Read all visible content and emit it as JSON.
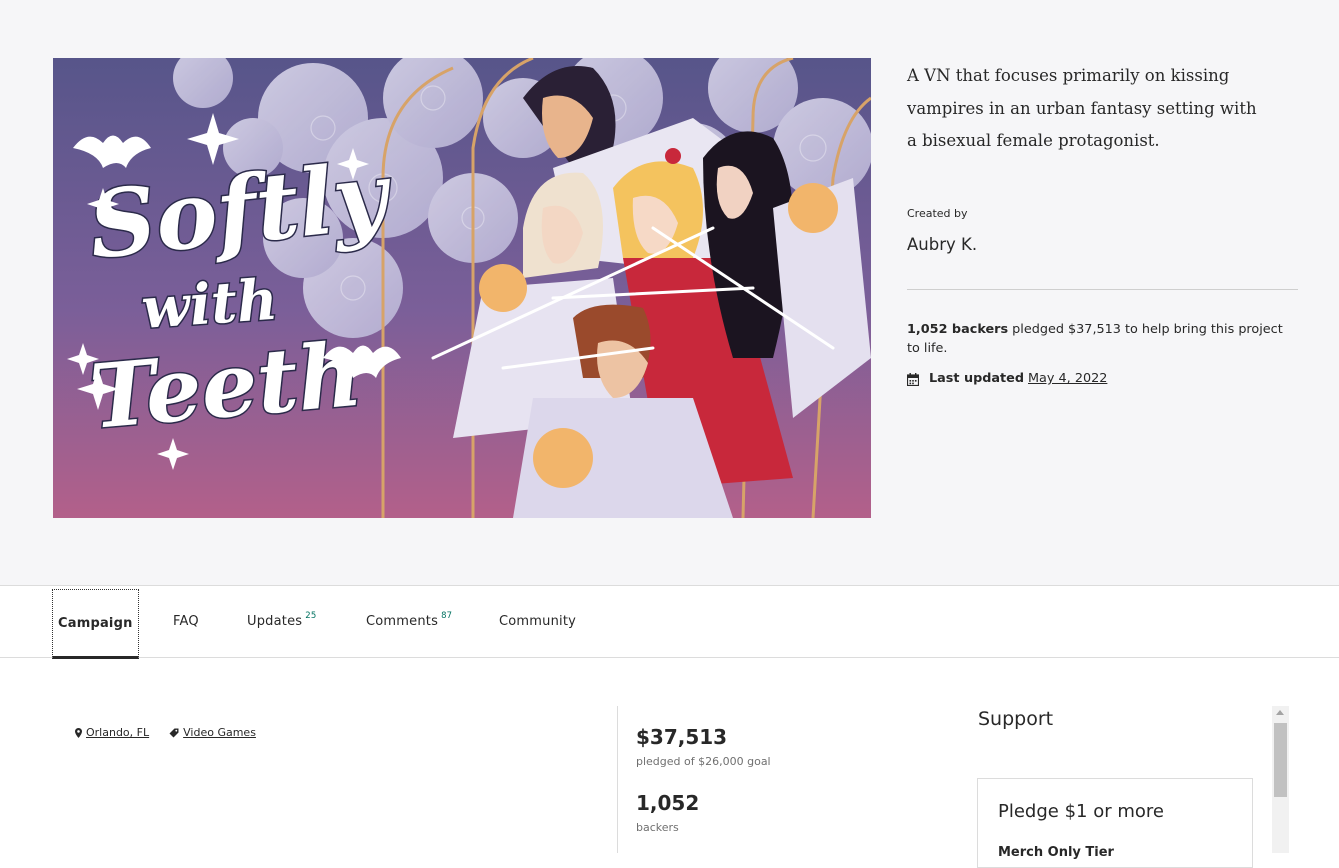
{
  "hero": {
    "image_title": "Softly with Teeth",
    "blurb": "A VN that focuses primarily on kissing vampires in an urban fantasy setting with a bisexual female protagonist.",
    "created_by_label": "Created by",
    "creator": "Aubry K.",
    "backers_bold": "1,052 backers",
    "pledged_text": " pledged $37,513 to help bring this project to life.",
    "last_updated_label": "Last updated",
    "last_updated_date": "May 4, 2022"
  },
  "tabs": [
    {
      "label": "Campaign",
      "count": ""
    },
    {
      "label": "FAQ",
      "count": ""
    },
    {
      "label": "Updates",
      "count": "25"
    },
    {
      "label": "Comments",
      "count": "87"
    },
    {
      "label": "Community",
      "count": ""
    }
  ],
  "meta": {
    "location": "Orlando, FL",
    "category": "Video Games"
  },
  "funding": {
    "amount": "$37,513",
    "goal_text": "pledged of $26,000 goal",
    "backers": "1,052",
    "backers_label": "backers"
  },
  "support": {
    "title": "Support",
    "pledge_amount": "Pledge $1 or more",
    "tier_name": "Merch Only Tier"
  },
  "colors": {
    "hero_bg": "#f6f6f8",
    "accent": "#037362",
    "art_purple": "#6a5c8f",
    "art_pink": "#b25c86",
    "dress_red": "#c8283b"
  }
}
